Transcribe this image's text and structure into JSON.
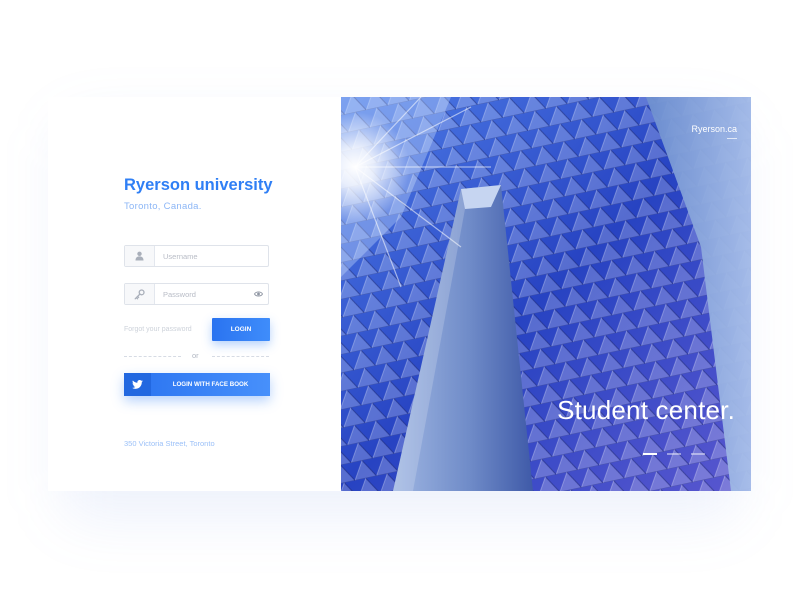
{
  "left_panel": {
    "brand_title": "Ryerson university",
    "brand_subtitle": "Toronto, Canada.",
    "username_placeholder": "Username",
    "password_placeholder": "Password",
    "forgot_password": "Forgot your password",
    "login_label": "LOGIN",
    "divider_text": "or",
    "social_login_label": "LOGIN WITH FACE BOOK",
    "address": "350 Victoria Street, Toronto"
  },
  "right_panel": {
    "site_link": "Ryerson.ca",
    "hero_title": "Student center.",
    "slider": {
      "count": 3,
      "active_index": 0
    }
  },
  "icons": {
    "username": "user-icon",
    "password": "key-icon",
    "show_password": "eye-icon",
    "social": "twitter-icon"
  },
  "colors": {
    "accent": "#2f7ff5",
    "accent_light": "#8cb6f6",
    "button_gradient_start": "#2a73f0",
    "button_gradient_end": "#3f8dfb",
    "input_border": "#dfe3ea",
    "muted_text": "#cdd2da"
  }
}
